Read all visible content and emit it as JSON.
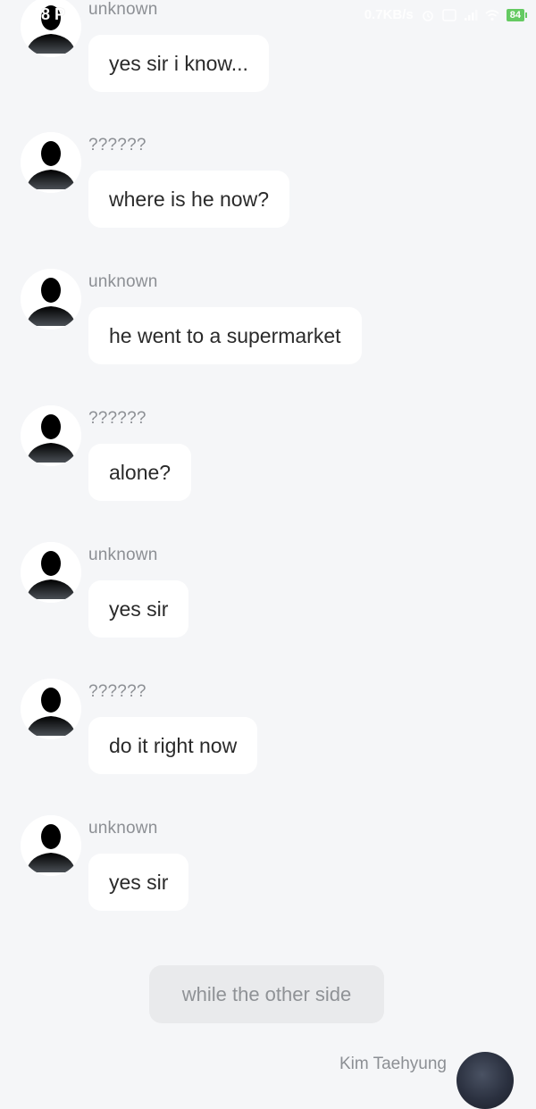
{
  "status_bar": {
    "time": "8 P",
    "network_speed": "0.7KB/s",
    "battery_level": "84",
    "icons": [
      "alarm-icon",
      "hd-icon",
      "signal-icon",
      "wifi-icon",
      "battery-icon"
    ]
  },
  "messages": [
    {
      "sender": "unknown",
      "text": "yes sir i know..."
    },
    {
      "sender": "??????",
      "text": "where is he now?"
    },
    {
      "sender": "unknown",
      "text": "he went to a supermarket"
    },
    {
      "sender": "??????",
      "text": "alone?"
    },
    {
      "sender": "unknown",
      "text": "yes sir"
    },
    {
      "sender": "??????",
      "text": "do it right now"
    },
    {
      "sender": "unknown",
      "text": "yes sir"
    }
  ],
  "narration": "while the other side",
  "next_message": {
    "sender": "Kim Taehyung"
  },
  "colors": {
    "background": "#f5f6f8",
    "bubble": "#ffffff",
    "narration_bg": "#e9eaec",
    "sender_text": "#8c8f94",
    "battery": "#5ec85a"
  }
}
